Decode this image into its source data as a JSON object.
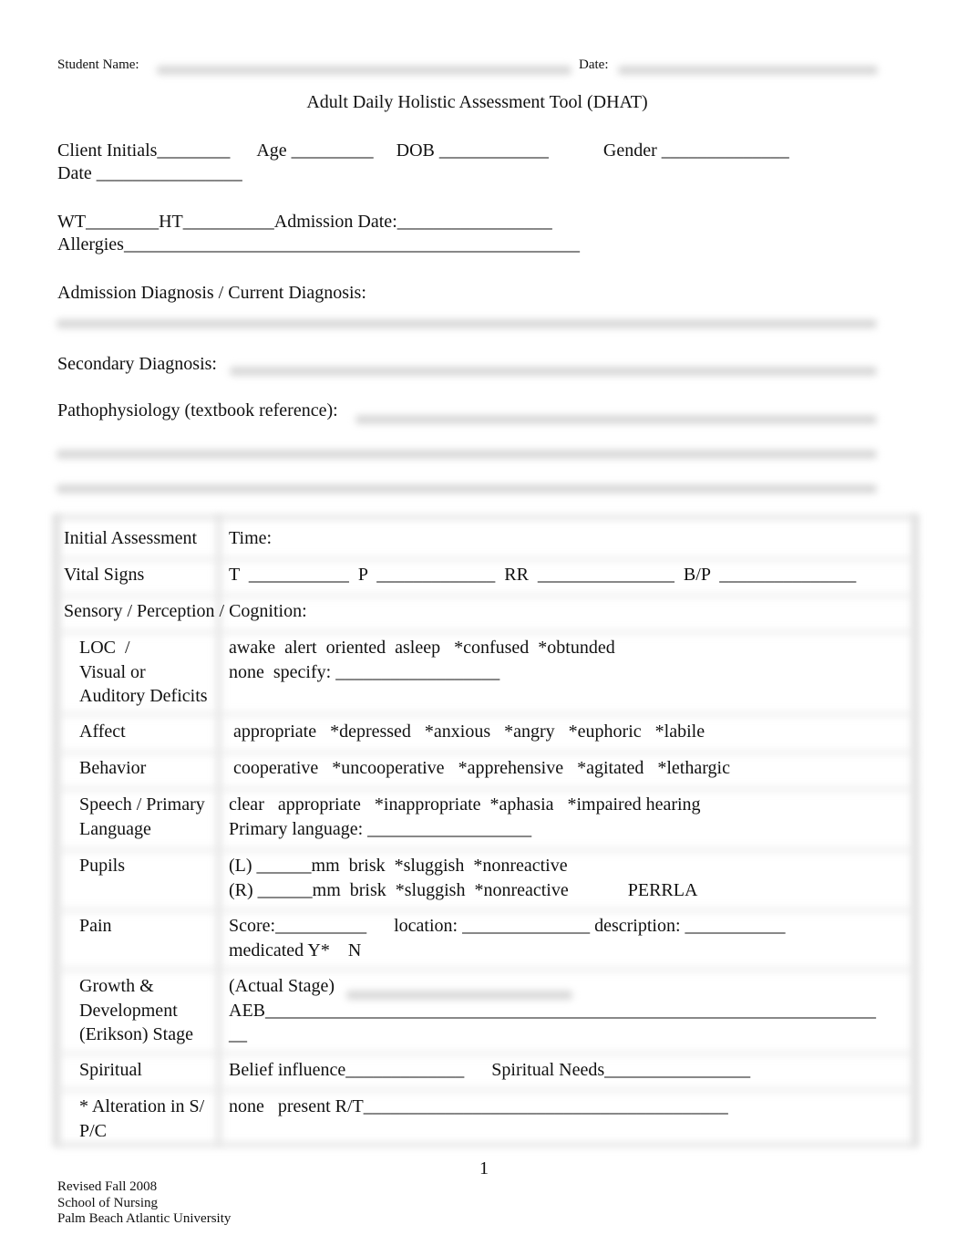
{
  "header": {
    "student_name_label": "Student Name:",
    "date_label": "Date:",
    "title": "Adult Daily Holistic Assessment Tool (DHAT)"
  },
  "client": {
    "line1": "Client Initials________      Age _________     DOB ____________            Gender ______________",
    "line2": "Date ________________",
    "line3": "WT________HT__________Admission Date:_________________",
    "line4": "Allergies__________________________________________________",
    "admission_dx": "Admission Diagnosis / Current Diagnosis:",
    "secondary_dx": "Secondary Diagnosis:",
    "patho": "Pathophysiology (textbook reference):"
  },
  "table": {
    "initial_label": "Initial Assessment",
    "initial_value": "Time:",
    "vitals_label": "Vital Signs",
    "vitals_value": "T  ___________  P  _____________  RR  _______________  B/P  _______________",
    "section": "Sensory / Perception / Cognition:",
    "rows": [
      {
        "label": [
          "LOC  /",
          "Visual or",
          "Auditory Deficits"
        ],
        "value": [
          "awake  alert  oriented  asleep   *confused  *obtunded",
          "none  specify: __________________"
        ]
      },
      {
        "label": [
          "Affect"
        ],
        "value": [
          " appropriate   *depressed   *anxious   *angry   *euphoric   *labile"
        ]
      },
      {
        "label": [
          "Behavior"
        ],
        "value": [
          " cooperative   *uncooperative   *apprehensive   *agitated   *lethargic"
        ]
      },
      {
        "label": [
          "Speech / Primary",
          "Language"
        ],
        "value": [
          "clear   appropriate   *inappropriate  *aphasia   *impaired hearing",
          "Primary language: __________________"
        ]
      },
      {
        "label": [
          "Pupils"
        ],
        "value": [
          "(L) ______mm  brisk  *sluggish  *nonreactive",
          "(R) ______mm  brisk  *sluggish  *nonreactive             PERRLA"
        ]
      },
      {
        "label": [
          "Pain"
        ],
        "value": [
          "Score:__________      location: ______________ description: ___________",
          "medicated Y*    N"
        ]
      },
      {
        "label": [
          "Growth &",
          "Development",
          "(Erikson) Stage"
        ],
        "value": [
          "(Actual Stage)",
          "AEB___________________________________________________________________",
          "__"
        ]
      },
      {
        "label": [
          "Spiritual"
        ],
        "value": [
          "Belief influence_____________      Spiritual Needs________________"
        ]
      },
      {
        "label": [
          "* Alteration in S/",
          "P/C"
        ],
        "value": [
          "none   present R/T________________________________________"
        ]
      }
    ]
  },
  "footer": {
    "page_number": "1",
    "revised": "Revised Fall 2008",
    "school": "School of Nursing",
    "university": "Palm Beach Atlantic University"
  }
}
